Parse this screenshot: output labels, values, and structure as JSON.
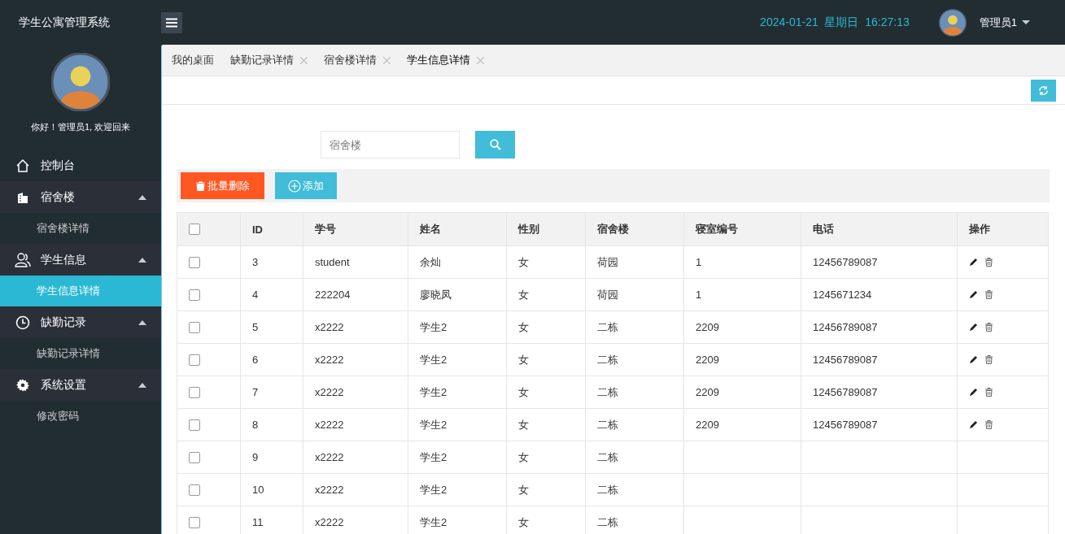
{
  "app_title": "学生公寓管理系统",
  "header": {
    "datetime": "2024-01-21  星期日  16:27:13",
    "user": "管理员1"
  },
  "sidebar": {
    "greeting": "你好！管理员1, 欢迎回来",
    "items": [
      {
        "label": "控制台",
        "selected": false
      },
      {
        "label": "宿舍楼",
        "selected": false,
        "expanded": true,
        "children": [
          {
            "label": "宿舍楼详情",
            "selected": false
          }
        ]
      },
      {
        "label": "学生信息",
        "selected": false,
        "expanded": true,
        "children": [
          {
            "label": "学生信息详情",
            "selected": true
          }
        ]
      },
      {
        "label": "缺勤记录",
        "selected": false,
        "expanded": true,
        "children": [
          {
            "label": "缺勤记录详情",
            "selected": false
          }
        ]
      },
      {
        "label": "系统设置",
        "selected": false,
        "expanded": true,
        "children": [
          {
            "label": "修改密码",
            "selected": false
          }
        ]
      }
    ]
  },
  "tabs": [
    {
      "label": "我的桌面",
      "closable": false,
      "selected": false
    },
    {
      "label": "缺勤记录详情",
      "closable": true,
      "selected": false
    },
    {
      "label": "宿舍楼详情",
      "closable": true,
      "selected": false
    },
    {
      "label": "学生信息详情",
      "closable": true,
      "selected": true
    }
  ],
  "search": {
    "placeholder": "宿舍楼"
  },
  "buttons": [
    {
      "label": "批量删除",
      "kind": "delete"
    },
    {
      "label": "添加",
      "kind": "add"
    }
  ],
  "table": {
    "select_all": {
      "checked": false
    },
    "columns": [
      "ID",
      "学号",
      "姓名",
      "性别",
      "宿舍楼",
      "寝室编号",
      "电话",
      "操作"
    ],
    "rows": [
      {
        "checked": false,
        "actions": true,
        "cells": [
          "3",
          "student",
          "余灿",
          "女",
          "荷园",
          "1",
          "12456789087"
        ]
      },
      {
        "checked": false,
        "actions": true,
        "cells": [
          "4",
          "222204",
          "廖晓凤",
          "女",
          "荷园",
          "1",
          "1245671234"
        ]
      },
      {
        "checked": false,
        "actions": true,
        "cells": [
          "5",
          "x2222",
          "学生2",
          "女",
          "二栋",
          "2209",
          "12456789087"
        ]
      },
      {
        "checked": false,
        "actions": true,
        "cells": [
          "6",
          "x2222",
          "学生2",
          "女",
          "二栋",
          "2209",
          "12456789087"
        ]
      },
      {
        "checked": false,
        "actions": true,
        "cells": [
          "7",
          "x2222",
          "学生2",
          "女",
          "二栋",
          "2209",
          "12456789087"
        ]
      },
      {
        "checked": false,
        "actions": true,
        "cells": [
          "8",
          "x2222",
          "学生2",
          "女",
          "二栋",
          "2209",
          "12456789087"
        ]
      },
      {
        "checked": false,
        "actions": false,
        "cells": [
          "9",
          "x2222",
          "学生2",
          "女",
          "二栋"
        ]
      },
      {
        "checked": false,
        "actions": false,
        "cells": [
          "10",
          "x2222",
          "学生2",
          "女",
          "二栋"
        ]
      },
      {
        "checked": false,
        "actions": false,
        "cells": [
          "11",
          "x2222",
          "学生2",
          "女",
          "二栋"
        ]
      }
    ]
  }
}
